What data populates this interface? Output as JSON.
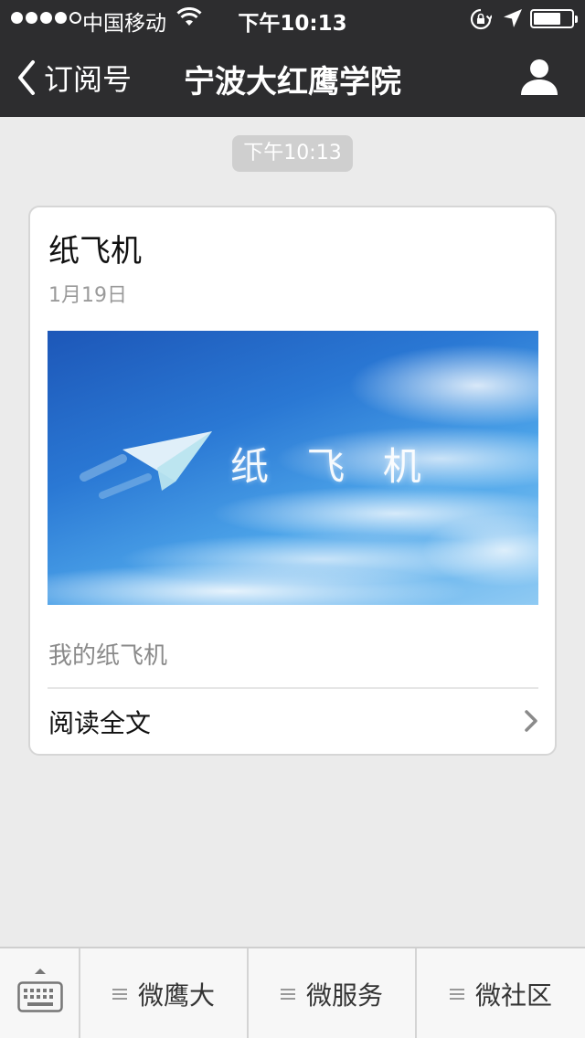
{
  "status_bar": {
    "carrier": "中国移动",
    "time": "下午10:13",
    "signal_bars_filled": 4,
    "signal_bars_total": 5,
    "battery_level_percent": 65,
    "icons": [
      "wifi-icon",
      "rotation-lock-icon",
      "location-arrow-icon",
      "battery-icon"
    ]
  },
  "nav": {
    "back_label": "订阅号",
    "title": "宁波大红鹰学院",
    "right_icon": "person-icon"
  },
  "message": {
    "timestamp": "下午10:13",
    "card": {
      "title": "纸飞机",
      "date": "1月19日",
      "cover_text": "纸 飞 机",
      "digest": "我的纸飞机",
      "read_more_label": "阅读全文"
    }
  },
  "bottom_menu": {
    "keyboard_icon": "keyboard-icon",
    "items": [
      {
        "label": "微鹰大",
        "icon": "menu-lines-icon"
      },
      {
        "label": "微服务",
        "icon": "menu-lines-icon"
      },
      {
        "label": "微社区",
        "icon": "menu-lines-icon"
      }
    ]
  },
  "colors": {
    "topbar": "#2d2d2f",
    "background": "#ebebeb",
    "card": "#ffffff",
    "secondary_text": "#9a9a9a"
  }
}
